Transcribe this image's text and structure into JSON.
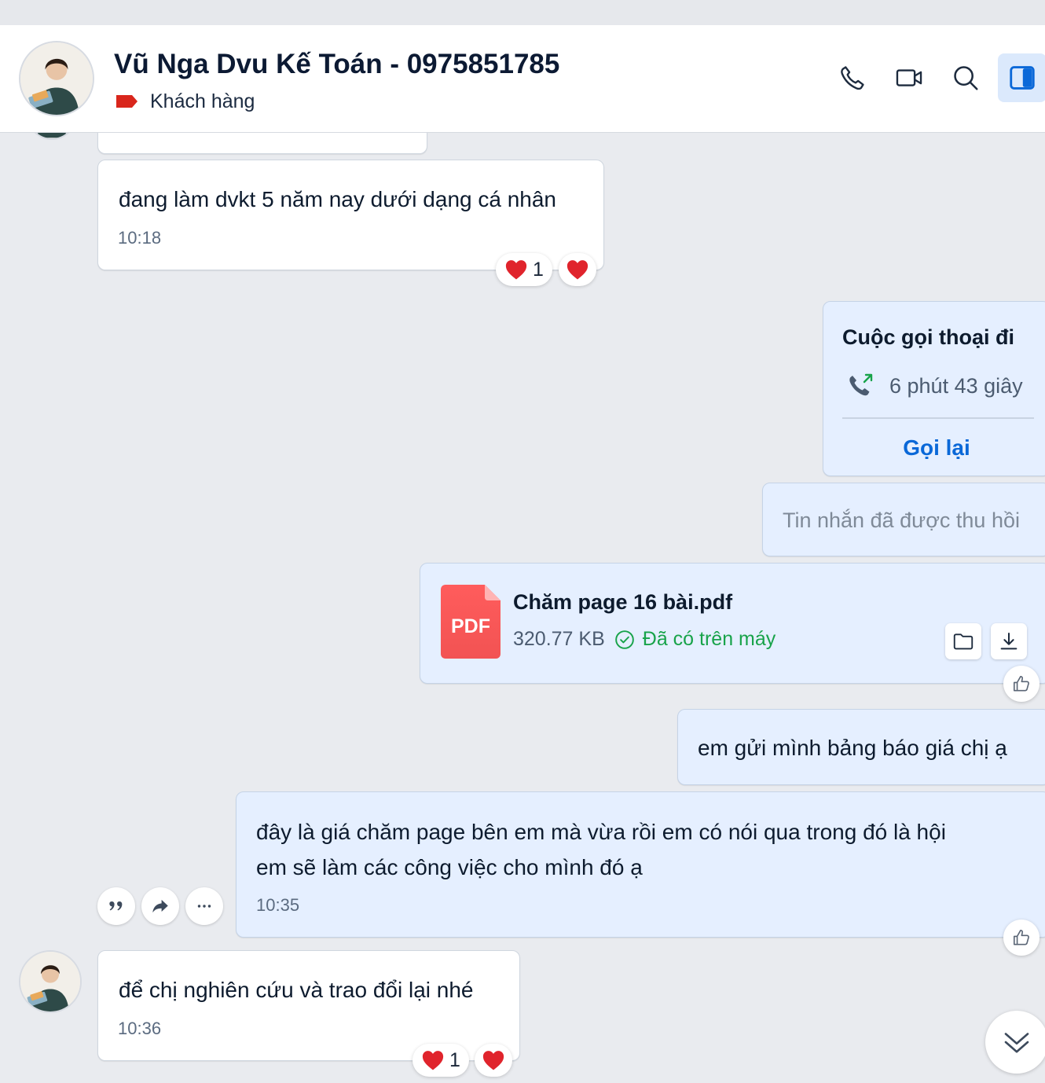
{
  "header": {
    "contact_name": "Vũ Nga Dvu Kế Toán - 0975851785",
    "tag_label": "Khách hàng",
    "tag_color": "#d9261c",
    "icons": [
      "phone-icon",
      "video-call-icon",
      "search-icon",
      "sidebar-toggle-icon"
    ]
  },
  "messages": {
    "m1": {
      "text": "đang làm dvkt 5 năm nay dưới dạng cá nhân",
      "time": "10:18",
      "reaction_count": "1"
    },
    "call": {
      "title": "Cuộc gọi thoại đi",
      "duration": "6 phút 43 giây",
      "callback_label": "Gọi lại"
    },
    "recalled": {
      "text": "Tin nhắn đã được thu hồi"
    },
    "file": {
      "name": "Chăm page 16 bài.pdf",
      "type_label": "PDF",
      "size": "320.77 KB",
      "status": "Đã có trên máy"
    },
    "m2": {
      "text": "em gửi mình bảng báo giá chị ạ"
    },
    "m3": {
      "line1": "đây là giá chăm page bên em mà vừa rồi em có nói qua trong đó là hội",
      "line2": "em sẽ làm các công việc cho mình đó ạ",
      "time": "10:35"
    },
    "m4": {
      "text": "để chị nghiên cứu và trao đổi lại nhé",
      "time": "10:36",
      "reaction_count": "1"
    }
  },
  "colors": {
    "accent": "#0a68d8",
    "outgoing_bubble": "#e5efff",
    "incoming_bubble": "#ffffff",
    "background": "#e9ebef",
    "heart": "#e0242c",
    "downloaded_status": "#18a34a"
  }
}
